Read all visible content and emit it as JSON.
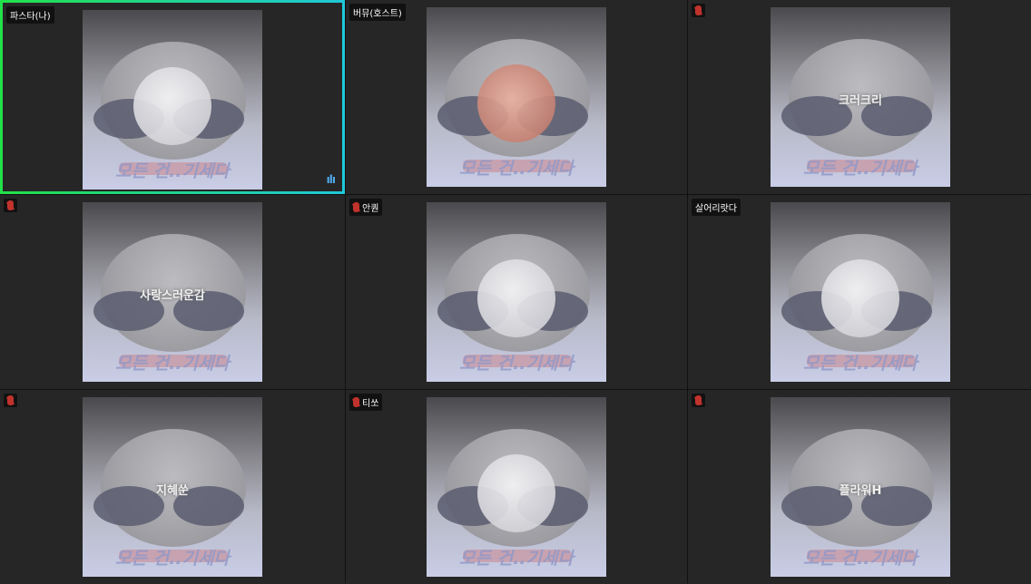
{
  "caption": "모든 건..기세다",
  "tiles": [
    {
      "name": "파스타(나)",
      "muted": false,
      "active": true,
      "avatar": "white",
      "overlay": ""
    },
    {
      "name": "버뮤(호스트)",
      "muted": false,
      "active": false,
      "avatar": "bear",
      "overlay": ""
    },
    {
      "name": "",
      "muted": true,
      "active": false,
      "avatar": "none",
      "overlay": "크러크리"
    },
    {
      "name": "",
      "muted": true,
      "active": false,
      "avatar": "none",
      "overlay": "사랑스러운감"
    },
    {
      "name": "안퀀",
      "muted": true,
      "active": false,
      "avatar": "white",
      "overlay": ""
    },
    {
      "name": "살어리랏다",
      "muted": false,
      "active": false,
      "avatar": "white",
      "overlay": ""
    },
    {
      "name": "",
      "muted": true,
      "active": false,
      "avatar": "none",
      "overlay": "지혜쑨"
    },
    {
      "name": "티쏘",
      "muted": true,
      "active": false,
      "avatar": "white",
      "overlay": ""
    },
    {
      "name": "",
      "muted": true,
      "active": false,
      "avatar": "none",
      "overlay": "플라워H"
    }
  ],
  "speaking_indicator": "ılı"
}
